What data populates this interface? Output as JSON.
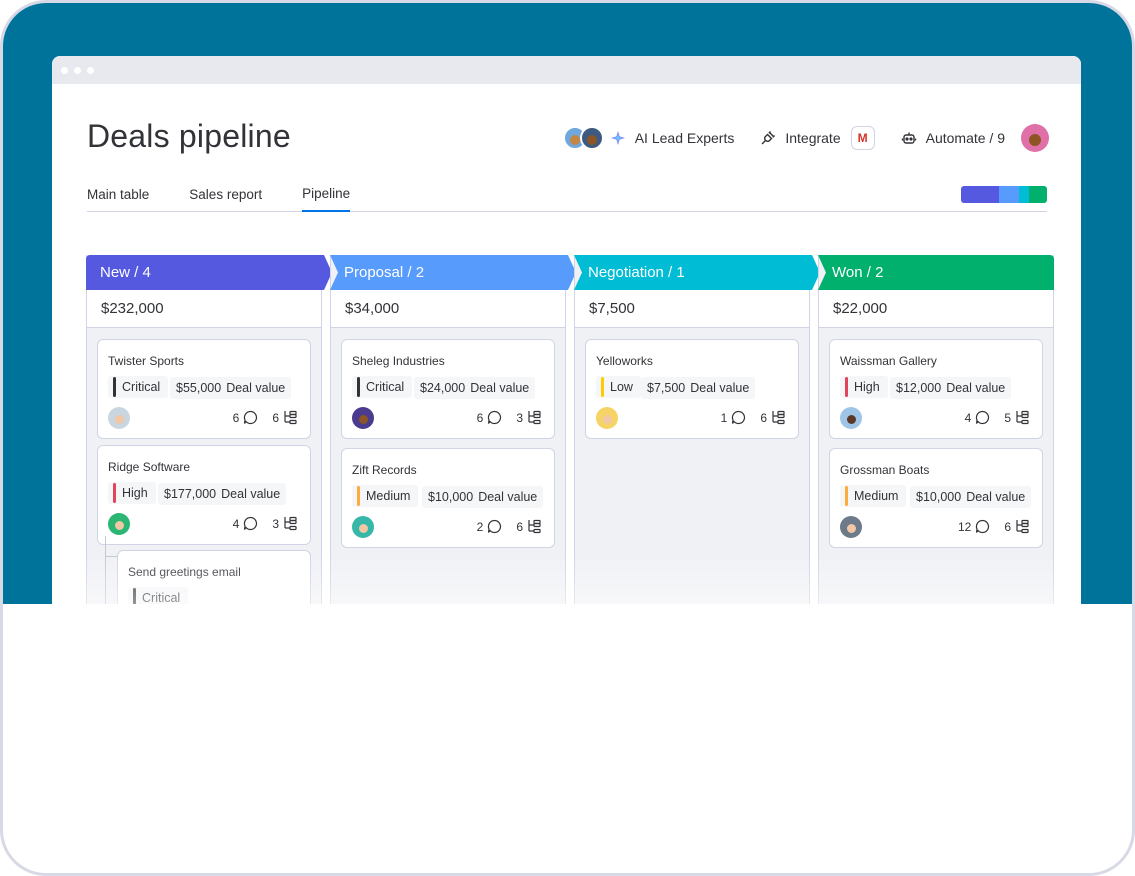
{
  "page": {
    "title": "Deals pipeline"
  },
  "toolbar": {
    "ai_label": "AI Lead Experts",
    "integrate_label": "Integrate",
    "gmail_letter": "M",
    "automate_label": "Automate / 9"
  },
  "tabs": [
    {
      "label": "Main table"
    },
    {
      "label": "Sales report"
    },
    {
      "label": "Pipeline"
    }
  ],
  "colors": {
    "new": "#5559df",
    "proposal": "#579bfc",
    "negotiation": "#00bcd5",
    "won": "#00b06c",
    "critical": "#333333",
    "high": "#e2445c",
    "medium": "#fdab3d",
    "low": "#ffcb00",
    "accent": "#0073ea"
  },
  "columns": [
    {
      "header": "New / 4",
      "total": "$232,000",
      "cards": [
        {
          "title": "Twister Sports",
          "priority": "Critical",
          "amount": "$55,000",
          "amount_label": "Deal value",
          "comments": "6",
          "subitems": "6"
        },
        {
          "title": "Ridge Software",
          "priority": "High",
          "amount": "$177,000",
          "amount_label": "Deal value",
          "comments": "4",
          "subitems": "3"
        },
        {
          "title": "Send greetings email",
          "priority": "Critical"
        }
      ]
    },
    {
      "header": "Proposal / 2",
      "total": "$34,000",
      "cards": [
        {
          "title": "Sheleg Industries",
          "priority": "Critical",
          "amount": "$24,000",
          "amount_label": "Deal value",
          "comments": "6",
          "subitems": "3"
        },
        {
          "title": "Zift Records",
          "priority": "Medium",
          "amount": "$10,000",
          "amount_label": "Deal value",
          "comments": "2",
          "subitems": "6"
        }
      ]
    },
    {
      "header": "Negotiation / 1",
      "total": "$7,500",
      "cards": [
        {
          "title": "Yelloworks",
          "priority": "Low",
          "amount": "$7,500",
          "amount_label": "Deal value",
          "comments": "1",
          "subitems": "6"
        }
      ]
    },
    {
      "header": "Won / 2",
      "total": "$22,000",
      "cards": [
        {
          "title": "Waissman Gallery",
          "priority": "High",
          "amount": "$12,000",
          "amount_label": "Deal value",
          "comments": "4",
          "subitems": "5"
        },
        {
          "title": "Grossman Boats",
          "priority": "Medium",
          "amount": "$10,000",
          "amount_label": "Deal value",
          "comments": "12",
          "subitems": "6"
        }
      ]
    }
  ],
  "icons": {
    "ai": "sparkle-icon",
    "integrate": "plug-icon",
    "automate": "robot-icon",
    "comment": "comment-bubble-icon",
    "subitems": "subitems-tree-icon"
  }
}
